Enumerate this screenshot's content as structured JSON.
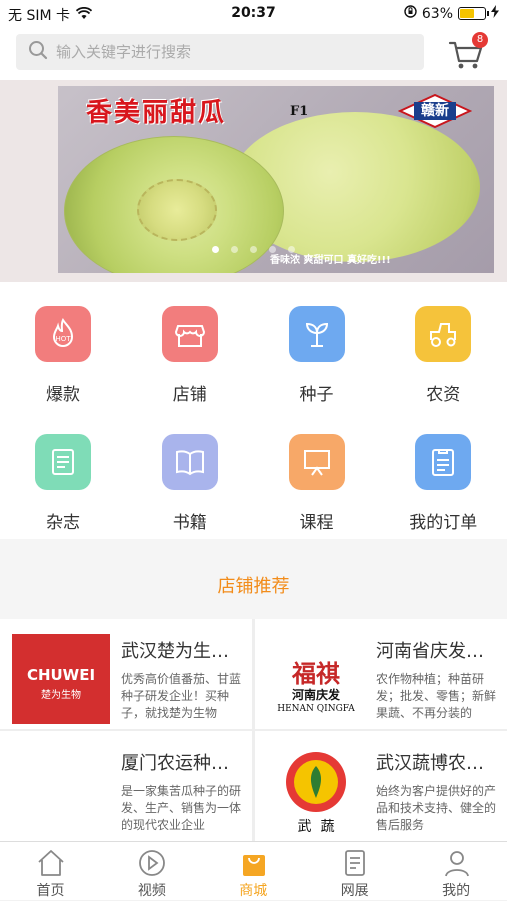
{
  "status_bar": {
    "carrier": "无 SIM 卡",
    "time": "20:37",
    "battery_text": "63%",
    "battery_level": 0.63
  },
  "search": {
    "placeholder": "输入关键字进行搜索"
  },
  "cart": {
    "badge_count": "8",
    "icon": "cart-icon"
  },
  "banner": {
    "title": "香美丽甜瓜",
    "title_suffix": "F1",
    "brand": "赣新",
    "tagline": "香味浓 爽甜可口 真好吃!!!",
    "slides": 5,
    "active_slide": 1
  },
  "categories": [
    {
      "label": "爆款",
      "icon": "hot-icon",
      "color": "#f27d7d"
    },
    {
      "label": "店铺",
      "icon": "store-icon",
      "color": "#f27d7d"
    },
    {
      "label": "种子",
      "icon": "sprout-icon",
      "color": "#6ea9f0"
    },
    {
      "label": "农资",
      "icon": "tractor-icon",
      "color": "#f5c33b"
    },
    {
      "label": "杂志",
      "icon": "magazine-icon",
      "color": "#7fdcb7"
    },
    {
      "label": "书籍",
      "icon": "book-icon",
      "color": "#a9b4ec"
    },
    {
      "label": "课程",
      "icon": "course-icon",
      "color": "#f7a868"
    },
    {
      "label": "我的订单",
      "icon": "order-icon",
      "color": "#6ea9f0"
    }
  ],
  "recommend": {
    "title": "店铺推荐"
  },
  "shops": [
    {
      "name": "武汉楚为生物科技有限公司",
      "desc": "优秀高价值番茄、甘蓝种子研发企业！买种子，就找楚为生物",
      "logo_text": "CHUWEI",
      "logo_sub": "楚为生物"
    },
    {
      "name": "河南省庆发种业有限公司",
      "desc": "农作物种植；种苗研发；批发、零售；新鲜果蔬、不再分装的",
      "logo_text": "福祺",
      "logo_mid": "河南庆发",
      "logo_sub": "HENAN QINGFA"
    },
    {
      "name": "厦门农运种苗有限公司",
      "desc": "是一家集苦瓜种子的研发、生产、销售为一体的现代农业企业"
    },
    {
      "name": "武汉蔬博农业科技有限公司",
      "desc": "始终为客户提供好的产品和技术支持、健全的售后服务",
      "logo_text": "武  蔬"
    }
  ],
  "tabbar": [
    {
      "label": "首页",
      "icon": "home-icon"
    },
    {
      "label": "视频",
      "icon": "play-icon"
    },
    {
      "label": "商城",
      "icon": "shopping-bag-icon",
      "active": true
    },
    {
      "label": "网展",
      "icon": "document-icon"
    },
    {
      "label": "我的",
      "icon": "user-icon"
    }
  ],
  "colors": {
    "accent": "#f5a623",
    "recommend_title": "#f28c1a",
    "badge": "#e53935"
  }
}
